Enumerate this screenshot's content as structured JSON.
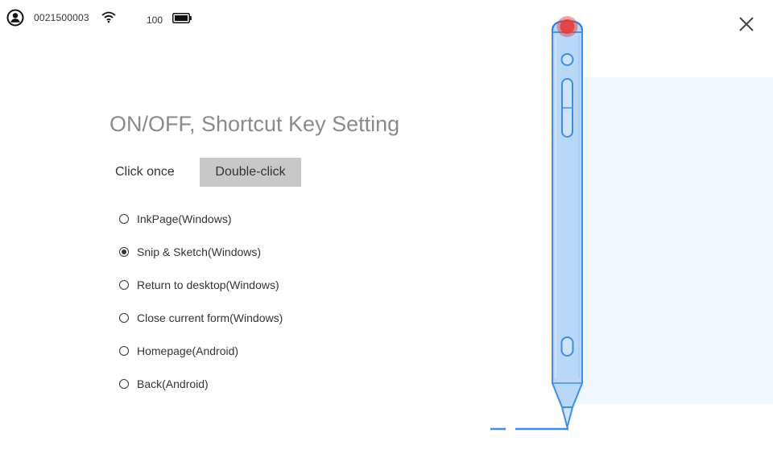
{
  "status": {
    "user_icon": "user-circle-icon",
    "device_id": "0021500003",
    "wifi_icon": "wifi-icon",
    "battery_level": "100",
    "battery_icon": "battery-icon"
  },
  "window": {
    "close_icon": "close-icon"
  },
  "page": {
    "title": "ON/OFF, Shortcut Key Setting"
  },
  "tabs": {
    "click_once": "Click once",
    "double_click": "Double-click",
    "selected": "Double-click"
  },
  "options": [
    {
      "label": "InkPage(Windows)",
      "checked": false
    },
    {
      "label": "Snip & Sketch(Windows)",
      "checked": true
    },
    {
      "label": "Return to desktop(Windows)",
      "checked": false
    },
    {
      "label": "Close current form(Windows)",
      "checked": false
    },
    {
      "label": "Homepage(Android)",
      "checked": false
    },
    {
      "label": "Back(Android)",
      "checked": false
    }
  ],
  "colors": {
    "pen_fill": "#b9d8f8",
    "pen_outline": "#3f8ee6",
    "highlight_button": "#e53935",
    "panel_background": "#f0f7fe",
    "selected_tab": "#c8c8c8",
    "title_text": "#8a8a8a"
  }
}
